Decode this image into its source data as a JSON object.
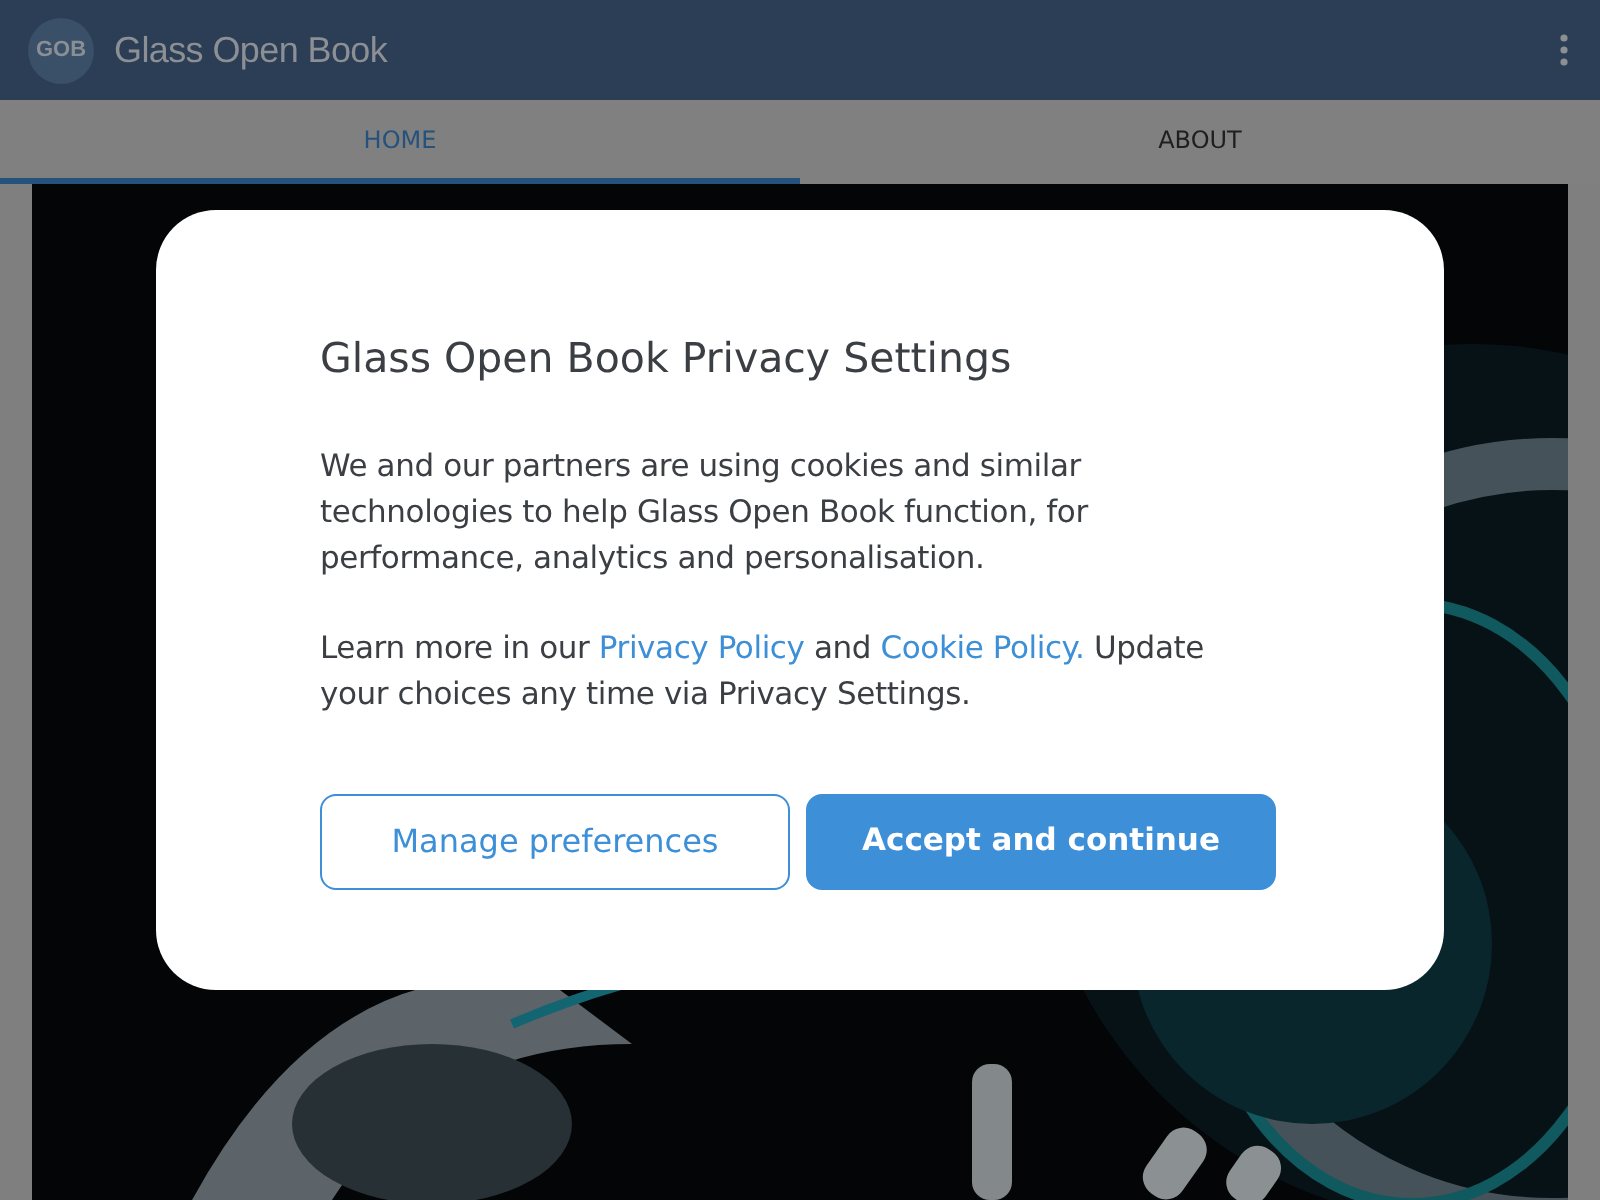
{
  "app_bar": {
    "logo": "GOB",
    "title": "Glass Open Book"
  },
  "tabs": [
    {
      "label": "HOME",
      "selected": true
    },
    {
      "label": "ABOUT",
      "selected": false
    }
  ],
  "dialog": {
    "title": "Glass Open Book Privacy Settings",
    "paragraph": "We and our partners are using cookies and similar technologies to help Glass Open Book function, for performance, analytics and personalisation.",
    "links_paragraph": [
      {
        "kind": "text",
        "text": "Learn more in our "
      },
      {
        "kind": "link",
        "text": "Privacy Policy"
      },
      {
        "kind": "text",
        "text": " and "
      },
      {
        "kind": "link",
        "text": "Cookie Policy."
      },
      {
        "kind": "text",
        "text": " Update your choices any time via Privacy Settings."
      }
    ],
    "buttons": [
      {
        "label": "Manage preferences",
        "kind": "outline"
      },
      {
        "label": "Accept and continue",
        "kind": "primary"
      }
    ]
  }
}
